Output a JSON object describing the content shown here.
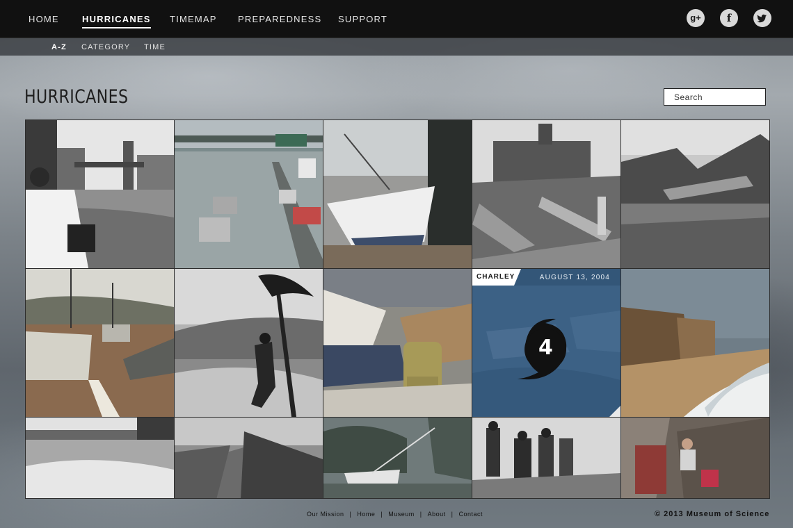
{
  "nav": {
    "items": [
      {
        "label": "HOME"
      },
      {
        "label": "HURRICANES"
      },
      {
        "label": "TIMEMAP"
      },
      {
        "label": "PREPAREDNESS"
      },
      {
        "label": "SUPPORT"
      }
    ],
    "active": "HURRICANES",
    "social": [
      {
        "icon": "google-plus-icon",
        "glyph": "g+"
      },
      {
        "icon": "facebook-icon",
        "glyph": "f"
      },
      {
        "icon": "twitter-icon",
        "glyph": "t"
      }
    ]
  },
  "subnav": {
    "items": [
      {
        "label": "A-Z"
      },
      {
        "label": "CATEGORY"
      },
      {
        "label": "TIME"
      }
    ],
    "active": "A-Z"
  },
  "page": {
    "title": "HURRICANES",
    "search_placeholder": "Search"
  },
  "featured": {
    "name": "CHARLEY",
    "date": "AUGUST 13, 2004",
    "category": "4"
  },
  "colors": {
    "nav_bg": "#111111",
    "feature_blue": "#3a5f83",
    "feature_bar": "#335678"
  },
  "footer": {
    "links": [
      {
        "label": "Our Mission"
      },
      {
        "label": "Home"
      },
      {
        "label": "Museum"
      },
      {
        "label": "About"
      },
      {
        "label": "Contact"
      }
    ],
    "copyright": "©  2013 Museum of Science"
  }
}
